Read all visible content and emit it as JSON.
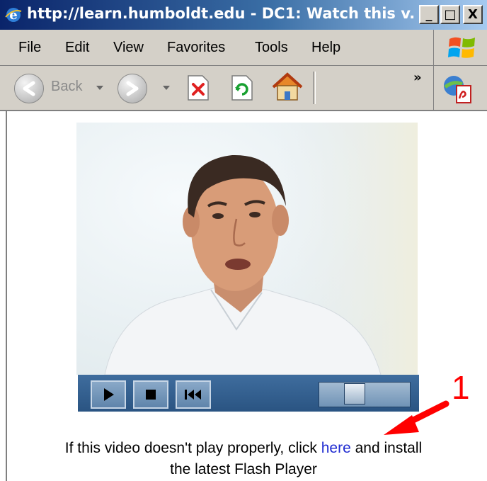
{
  "window": {
    "title": "http://learn.humboldt.edu - DC1: Watch this v...",
    "minimize": "_",
    "maximize": "□",
    "close": "X"
  },
  "menu": [
    "File",
    "Edit",
    "View",
    "Favorites",
    "Tools",
    "Help"
  ],
  "toolbar": {
    "back_label": "Back",
    "overflow": "»"
  },
  "video": {
    "caption_before": "If this video doesn't play properly, click ",
    "link_text": "here",
    "caption_after": " and install",
    "caption_line2": "the latest Flash Player",
    "seek_position": 0.32
  },
  "annotation": {
    "number": "1",
    "color": "#ff0000"
  },
  "colors": {
    "titlebar_start": "#0a246a",
    "chrome": "#d4d0c8",
    "player_bar": "#2f5d8f",
    "link": "#1f2bd1"
  }
}
